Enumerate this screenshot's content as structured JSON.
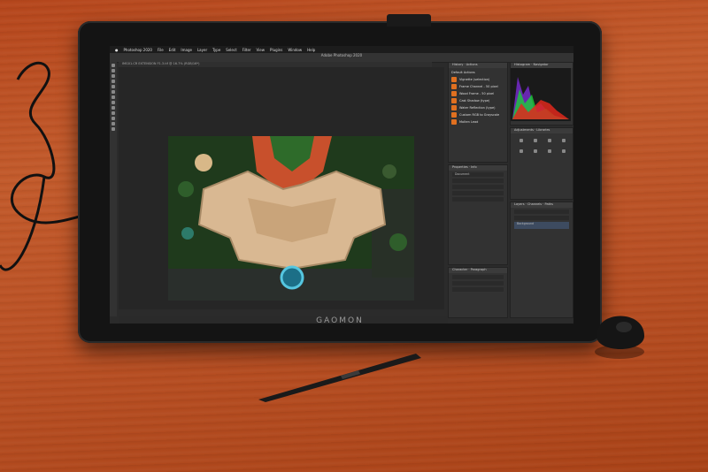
{
  "device": {
    "brand": "GAOMON"
  },
  "app": {
    "window_title": "Adobe Photoshop 2020",
    "menu": [
      "Photoshop 2020",
      "File",
      "Edit",
      "Image",
      "Layer",
      "Type",
      "Select",
      "Filter",
      "View",
      "Plugins",
      "Window",
      "Help"
    ],
    "document_tab": "IMG01.CR EXTENSION F1.3.tif @ 16.7% (RGB/16*)",
    "context_bar_label": "Generative Expand"
  },
  "panels": {
    "history_tabs": [
      "History",
      "Actions"
    ],
    "actions": [
      "Default Actions",
      "Vignette (selection)",
      "Frame Channel - 50 pixel",
      "Wood Frame - 50 pixel",
      "Cast Shadow (type)",
      "Water Reflection (type)",
      "Custom RGB to Grayscale",
      "Molten Lead"
    ],
    "histogram_tabs": [
      "Histogram",
      "Navigator"
    ],
    "adjustments_tabs": [
      "Adjustments",
      "Libraries"
    ],
    "properties_tabs": [
      "Properties",
      "Info"
    ],
    "layers_tabs": [
      "Layers",
      "Channels",
      "Paths"
    ],
    "character_tabs": [
      "Actions",
      "Character",
      "Paragraph"
    ],
    "layer_name": "Background",
    "document_label": "Document"
  },
  "colors": {
    "accent": "#e07020",
    "bezel": "#141414",
    "desk": "#b95024"
  }
}
